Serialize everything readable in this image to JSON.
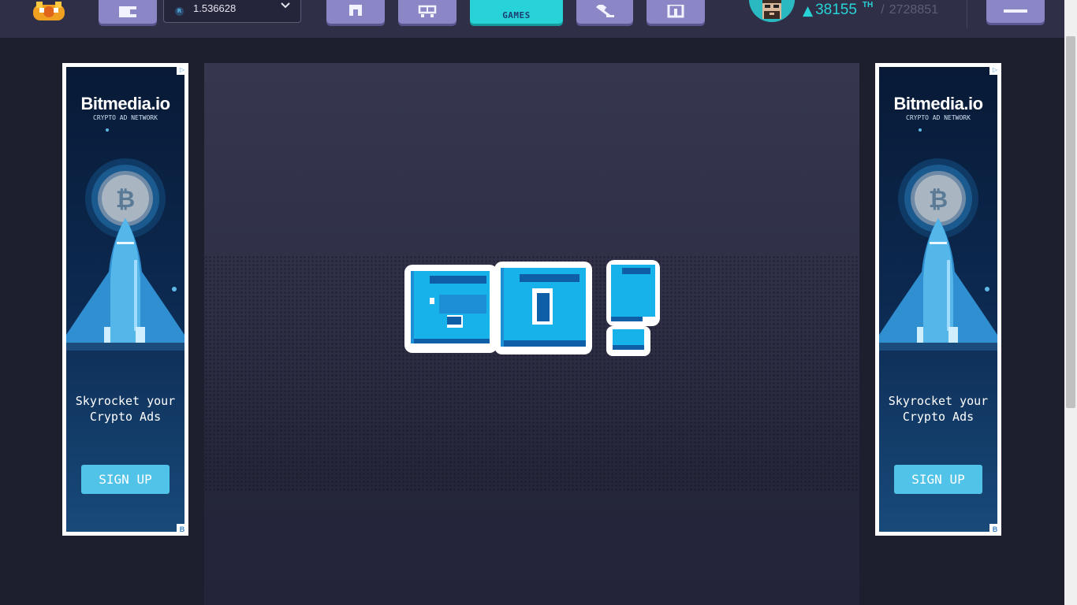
{
  "header": {
    "balance": {
      "currency_icon": "rlt-coin-icon",
      "value": "1.536628"
    },
    "nav": {
      "games_label": "GAMES"
    },
    "power": {
      "value": "38155",
      "unit": "TH",
      "separator": "/",
      "total": "2728851"
    }
  },
  "ads": {
    "left": {
      "brand": "Bitmedia.io",
      "tagline": "CRYPTO AD NETWORK",
      "headline": "Skyrocket your Crypto Ads",
      "cta": "SIGN UP"
    },
    "right": {
      "brand": "Bitmedia.io",
      "tagline": "CRYPTO AD NETWORK",
      "headline": "Skyrocket your Crypto Ads",
      "cta": "SIGN UP"
    }
  },
  "game": {
    "banner_text": "GO!"
  },
  "colors": {
    "accent": "#27d3d6",
    "nav_button": "#8b86c5",
    "background": "#1d1e2e",
    "ad_cta": "#52c3e8"
  }
}
